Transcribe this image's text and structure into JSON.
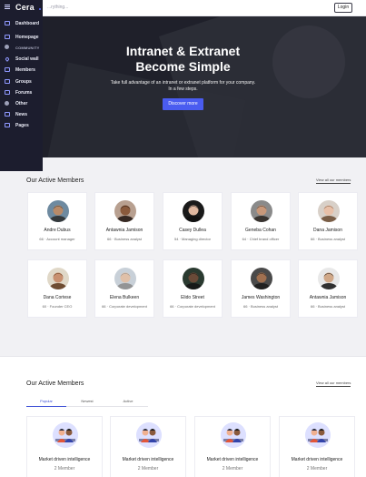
{
  "topbar": {
    "search_placeholder": "...rything...",
    "login_label": "Login"
  },
  "sidebar": {
    "brand": "Cera",
    "items": [
      {
        "label": "Dashboard",
        "icon": "dashboard-icon",
        "small": false
      },
      {
        "label": "Homepage",
        "icon": "home-icon",
        "small": false
      },
      {
        "label": "COMMUNITY",
        "icon": "dot-icon",
        "small": true
      },
      {
        "label": "Social wall",
        "icon": "heart-icon",
        "small": false
      },
      {
        "label": "Members",
        "icon": "members-icon",
        "small": false
      },
      {
        "label": "Groups",
        "icon": "groups-icon",
        "small": false
      },
      {
        "label": "Forums",
        "icon": "forums-icon",
        "small": false
      },
      {
        "label": "Other",
        "icon": "dot-icon",
        "small": false
      },
      {
        "label": "News",
        "icon": "news-icon",
        "small": false
      },
      {
        "label": "Pages",
        "icon": "pages-icon",
        "small": false
      }
    ]
  },
  "hero": {
    "title_line1": "Intranet & Extranet",
    "title_line2": "Become Simple",
    "subtitle": "Take full advantage of an intranet or extranet platform for your company. In a few steps.",
    "button": "Discover more"
  },
  "members": {
    "title": "Our Active Members",
    "view_all": "View all our members",
    "list": [
      {
        "name": "Andre Dubus",
        "role": "Account manager",
        "count": "66",
        "skin": "#b88a68",
        "hair": "#2a2a2a",
        "bg": "#6e8aa0"
      },
      {
        "name": "Antawnia Jamison",
        "role": "Business analyst",
        "count": "66",
        "skin": "#8a5a3c",
        "hair": "#1e1410",
        "bg": "#b8a090"
      },
      {
        "name": "Casey Dullea",
        "role": "Managing director",
        "count": "54",
        "skin": "#e0b8a0",
        "hair": "#111",
        "bg": "#1a1a1a"
      },
      {
        "name": "Geneba Cohan",
        "role": "Chief brand officer",
        "count": "64",
        "skin": "#c8987a",
        "hair": "#2a2420",
        "bg": "#8a8a8a"
      },
      {
        "name": "Dana Jamison",
        "role": "Business analyst",
        "count": "66",
        "skin": "#e8c0a8",
        "hair": "#6a4a30",
        "bg": "#d8d0c8"
      },
      {
        "name": "Dana Cortese",
        "role": "Founder CEO",
        "count": "60",
        "skin": "#c89070",
        "hair": "#5a3418",
        "bg": "#e0d8c8"
      },
      {
        "name": "Elena Bulkeen",
        "role": "Corporate development",
        "count": "66",
        "skin": "#e0c0a8",
        "hair": "#8a8a8a",
        "bg": "#c8d0d8"
      },
      {
        "name": "Elido Street",
        "role": "Corporate development",
        "count": "66",
        "skin": "#6a4a38",
        "hair": "#141414",
        "bg": "#2a3a30"
      },
      {
        "name": "James Washington",
        "role": "Business analyst",
        "count": "66",
        "skin": "#a07050",
        "hair": "#1a1a1a",
        "bg": "#4a4a4a"
      },
      {
        "name": "Antawnia Jamison",
        "role": "Business analyst",
        "count": "66",
        "skin": "#d0a888",
        "hair": "#101010",
        "bg": "#e8e8e8"
      }
    ]
  },
  "groups": {
    "title": "Our Active Members",
    "view_all": "View all our members",
    "tabs": [
      "Popular",
      "Newest",
      "Active"
    ],
    "list": [
      {
        "name": "Market driven intelligence",
        "count": "2 Member"
      },
      {
        "name": "Market driven intelligence",
        "count": "2 Member"
      },
      {
        "name": "Market driven intelligence",
        "count": "2 Member"
      },
      {
        "name": "Market driven intelligence",
        "count": "2 Member"
      }
    ]
  },
  "colors": {
    "accent": "#4a5cf0",
    "sidebar": "#1c1d2e"
  }
}
